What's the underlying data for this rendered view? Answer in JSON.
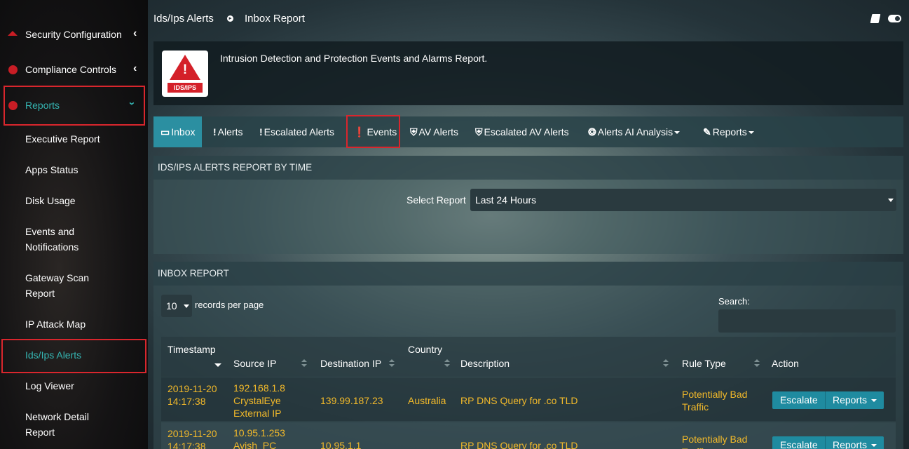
{
  "sidebar": {
    "items": [
      {
        "label": "Security Configuration"
      },
      {
        "label": "Compliance Controls"
      },
      {
        "label": "Reports"
      }
    ],
    "reports_children": [
      "Executive Report",
      "Apps Status",
      "Disk Usage",
      "Events and Notifications",
      "Gateway Scan Report",
      "IP Attack Map",
      "Ids/Ips Alerts",
      "Log Viewer",
      "Network Detail Report"
    ]
  },
  "header": {
    "crumb1": "Ids/Ips Alerts",
    "crumb2": "Inbox Report"
  },
  "info": {
    "logo_text": "IDS/IPS",
    "description": "Intrusion Detection and Protection Events and Alarms Report."
  },
  "tabs": [
    {
      "label": "Inbox",
      "icon": "inbox-icon"
    },
    {
      "label": "Alerts",
      "icon": "exclamation-icon"
    },
    {
      "label": "Escalated Alerts",
      "icon": "exclamation-icon"
    },
    {
      "label": "Events",
      "icon": "exclamation-circle-icon"
    },
    {
      "label": "AV Alerts",
      "icon": "shield-icon"
    },
    {
      "label": "Escalated AV Alerts",
      "icon": "shield-icon"
    },
    {
      "label": "Alerts AI Analysis",
      "icon": "ai-icon"
    },
    {
      "label": "Reports",
      "icon": "pencil-icon"
    }
  ],
  "time_panel": {
    "title": "IDS/IPS ALERTS REPORT BY TIME",
    "select_label": "Select Report",
    "selected": "Last 24 Hours"
  },
  "inbox_panel": {
    "title": "INBOX REPORT",
    "page_length": "10",
    "page_length_label": "records per page",
    "search_label": "Search:",
    "columns": [
      "Timestamp",
      "Source IP",
      "Destination IP",
      "Country",
      "Description",
      "Rule Type",
      "Action"
    ],
    "rows": [
      {
        "timestamp_date": "2019-11-20",
        "timestamp_time": "14:17:38",
        "source_ip": "192.168.1.8",
        "source_name": "CrystalEye External IP",
        "destination_ip": "139.99.187.23",
        "country": "Australia",
        "description": "RP DNS Query for .co TLD",
        "rule_type": "Potentially Bad Traffic",
        "escalate": "Escalate",
        "reports": "Reports"
      },
      {
        "timestamp_date": "2019-11-20",
        "timestamp_time": "14:17:38",
        "source_ip": "10.95.1.253",
        "source_name": "Avish_PC",
        "destination_ip": "10.95.1.1",
        "country": "",
        "description": "RP DNS Query for .co TLD",
        "rule_type": "Potentially Bad Traffic",
        "escalate": "Escalate",
        "reports": "Reports"
      }
    ]
  },
  "colors": {
    "accent": "#2b8fa1",
    "highlight_red": "#d9262d",
    "value_text": "#f2b92a",
    "active_sidebar": "#35b6b3"
  }
}
